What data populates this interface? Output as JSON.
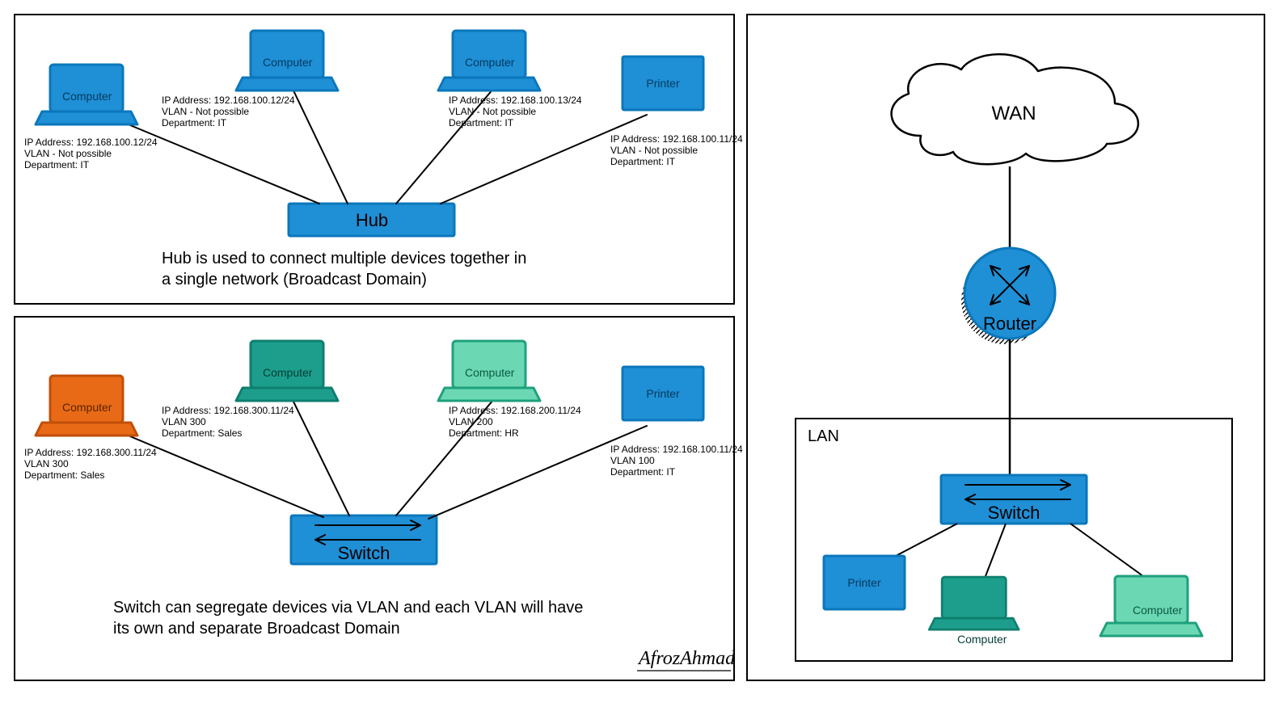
{
  "colors": {
    "blue": "#1f8fd6",
    "blueStroke": "#0b77bb",
    "orange": "#e86a17",
    "orangeStroke": "#c14f09",
    "teal": "#1d9e8c",
    "tealStroke": "#0e7e6e",
    "mint": "#6bd7b3",
    "mintStroke": "#1fa07c",
    "black": "#000000"
  },
  "hub": {
    "label": "Hub",
    "caption1": "Hub is used to connect multiple devices together in",
    "caption2": "a single network (Broadcast Domain)",
    "dev": [
      {
        "type": "computer",
        "label": "Computer",
        "ip": "IP Address: 192.168.100.12/24",
        "vlan": "VLAN - Not possible",
        "dept": "Department: IT"
      },
      {
        "type": "computer",
        "label": "Computer",
        "ip": "IP Address: 192.168.100.12/24",
        "vlan": "VLAN - Not possible",
        "dept": "Department: IT"
      },
      {
        "type": "computer",
        "label": "Computer",
        "ip": "IP Address: 192.168.100.13/24",
        "vlan": "VLAN - Not possible",
        "dept": "Department: IT"
      },
      {
        "type": "printer",
        "label": "Printer",
        "ip": "IP Address: 192.168.100.11/24",
        "vlan": "VLAN - Not possible",
        "dept": "Department: IT"
      }
    ]
  },
  "switch": {
    "label": "Switch",
    "caption1": "Switch can segregate devices via VLAN and each VLAN will have",
    "caption2": "its own and separate Broadcast Domain",
    "dev": [
      {
        "type": "computer",
        "label": "Computer",
        "ip": "IP Address: 192.168.300.11/24",
        "vlan": "VLAN 300",
        "dept": "Department: Sales"
      },
      {
        "type": "computer",
        "label": "Computer",
        "ip": "IP Address: 192.168.300.11/24",
        "vlan": "VLAN 300",
        "dept": "Department: Sales"
      },
      {
        "type": "computer",
        "label": "Computer",
        "ip": "IP Address: 192.168.200.11/24",
        "vlan": "VLAN 200",
        "dept": "Department: HR"
      },
      {
        "type": "printer",
        "label": "Printer",
        "ip": "IP Address: 192.168.100.11/24",
        "vlan": "VLAN 100",
        "dept": "Department: IT"
      }
    ]
  },
  "right": {
    "wan": "WAN",
    "router": "Router",
    "lan": "LAN",
    "switch": "Switch",
    "printer": "Printer",
    "computer": "Computer"
  },
  "credit": "AfrozAhmad"
}
